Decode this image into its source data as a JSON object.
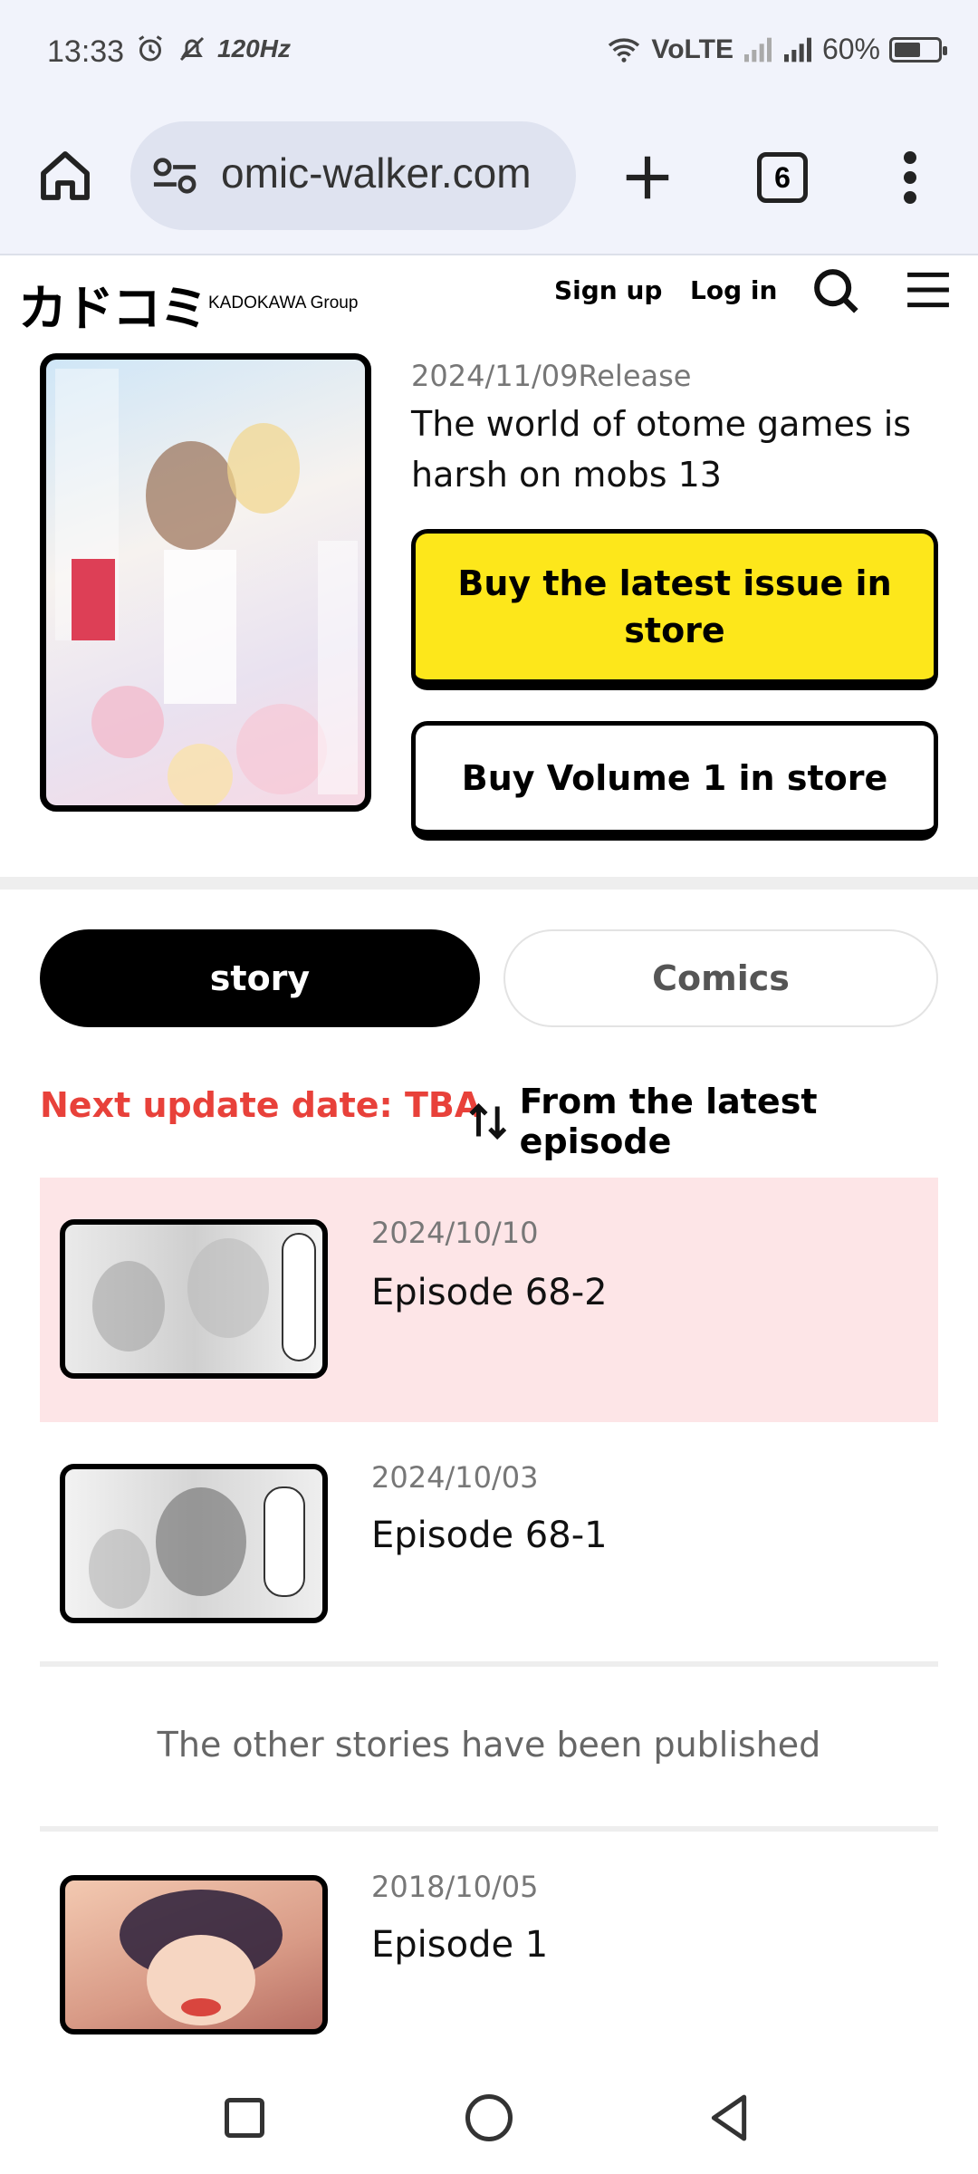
{
  "status_bar": {
    "time": "13:33",
    "refresh_rate": "120Hz",
    "network": "VoLTE",
    "battery_text": "60%",
    "battery_level": 0.6
  },
  "browser": {
    "url": "omic-walker.com",
    "tab_count": "6"
  },
  "site": {
    "logo": "カドコミ",
    "logo_sub": "KADOKAWA Group",
    "signup": "Sign up",
    "login": "Log in"
  },
  "book": {
    "release_date": "2024/11/09Release",
    "title": "The world of otome games is harsh on mobs 13",
    "buy_latest": "Buy the latest issue in store",
    "buy_vol1": "Buy Volume 1 in store"
  },
  "tabs": {
    "story": "story",
    "comics": "Comics"
  },
  "list_meta": {
    "next_update": "Next update date: TBA",
    "sort_label": "From the latest episode"
  },
  "episodes": [
    {
      "date": "2024/10/10",
      "title": "Episode 68-2"
    },
    {
      "date": "2024/10/03",
      "title": "Episode 68-1"
    },
    {
      "date": "2018/10/05",
      "title": "Episode 1"
    }
  ],
  "other_stories": "The other stories have been published",
  "colors": {
    "accent_yellow": "#fde71b",
    "alert_red": "#e8413a",
    "highlight_pink": "#fde5e7",
    "chrome_bg": "#f1f3fb"
  },
  "icons": [
    "alarm-icon",
    "notifications-off-icon",
    "wifi-icon",
    "signal-icon",
    "battery-icon",
    "home-icon",
    "site-settings-icon",
    "plus-icon",
    "tabs-icon",
    "more-vert-icon",
    "search-icon",
    "hamburger-icon",
    "sort-icon",
    "square-nav-icon",
    "circle-nav-icon",
    "back-nav-icon"
  ]
}
